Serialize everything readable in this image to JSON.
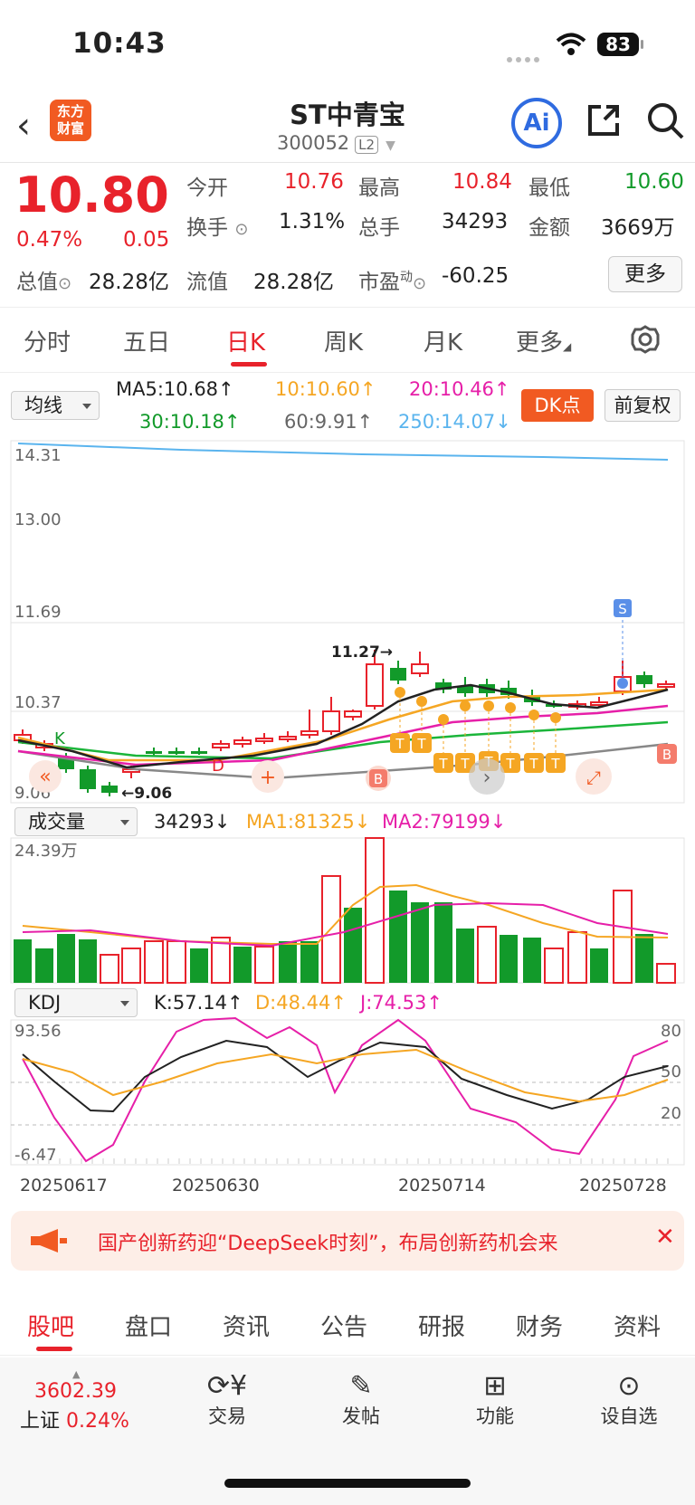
{
  "status": {
    "time": "10:43",
    "battery": "83"
  },
  "header": {
    "back": "‹",
    "logo_line1": "东方",
    "logo_line2": "财富",
    "name": "ST中青宝",
    "code": "300052",
    "level": "L2",
    "ai": "Ai"
  },
  "quote": {
    "price": "10.80",
    "pct": "0.47%",
    "chg": "0.05",
    "open_label": "今开",
    "open": "10.76",
    "high_label": "最高",
    "high": "10.84",
    "low_label": "最低",
    "low": "10.60",
    "turnover_label": "换手",
    "turnover": "1.31%",
    "volume_label": "总手",
    "volume": "34293",
    "amount_label": "金额",
    "amount": "3669万",
    "mktcap_label": "总值",
    "mktcap": "28.28亿",
    "float_label": "流值",
    "float": "28.28亿",
    "pe_label": "市盈",
    "pe_sup": "动",
    "pe": "-60.25",
    "more": "更多"
  },
  "tabs": [
    "分时",
    "五日",
    "日K",
    "周K",
    "月K",
    "更多"
  ],
  "ma": {
    "select": "均线",
    "ma5": "MA5:10.68↑",
    "ma10": "10:10.60↑",
    "ma20": "20:10.46↑",
    "ma30": "30:10.18↑",
    "ma60": "60:9.91↑",
    "ma250": "250:14.07↓",
    "dk": "DK点",
    "fq": "前复权"
  },
  "kline": {
    "y_labels": [
      "14.31",
      "13.00",
      "11.69",
      "10.37",
      "9.06"
    ],
    "max_label": "11.27→",
    "min_label": "←9.06",
    "K_mark": "K",
    "D_mark": "D",
    "S_mark": "S",
    "B_mark": "B",
    "T_mark": "T"
  },
  "volume": {
    "select": "成交量",
    "vol": "34293↓",
    "ma1": "MA1:81325↓",
    "ma2": "MA2:79199↓",
    "y_label": "24.39万"
  },
  "kdj": {
    "select": "KDJ",
    "k": "K:57.14↑",
    "d": "D:48.44↑",
    "j": "J:74.53↑",
    "top": "93.56",
    "bottom": "-6.47",
    "r80": "80",
    "r50": "50",
    "r20": "20"
  },
  "dates": [
    "20250617",
    "20250630",
    "20250714",
    "20250728"
  ],
  "banner": "国产创新药迎“DeepSeek时刻”，布局创新药机会来",
  "bottom_tabs": [
    "股吧",
    "盘口",
    "资讯",
    "公告",
    "研报",
    "财务",
    "资料"
  ],
  "index": {
    "value": "3602.39",
    "name": "上证",
    "pct": "0.24%"
  },
  "nav": [
    "交易",
    "发帖",
    "功能",
    "设自选"
  ],
  "colors": {
    "up": "#e8222b",
    "down": "#129a2a",
    "brand": "#f15a22"
  }
}
